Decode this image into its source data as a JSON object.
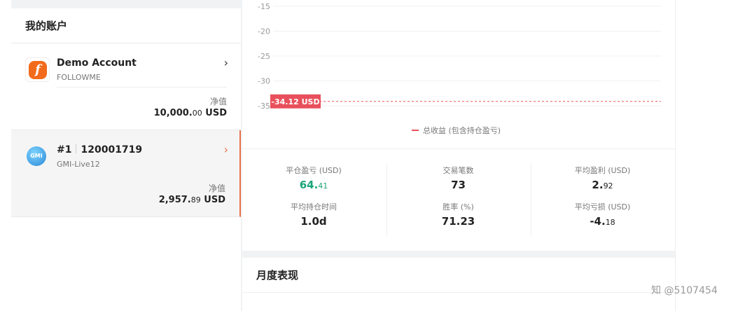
{
  "sidebar": {
    "title": "我的账户",
    "accounts": [
      {
        "name": "Demo Account",
        "broker": "FOLLOWME",
        "equity_label": "净值",
        "equity_int": "10,000.",
        "equity_dec": "00",
        "currency": "USD",
        "logo": "followme-logo"
      },
      {
        "number": "#1",
        "account_id": "120001719",
        "broker": "GMI-Live12",
        "equity_label": "净值",
        "equity_int": "2,957.",
        "equity_dec": "89",
        "currency": "USD",
        "logo": "gmi-logo",
        "logo_text": "GMI",
        "selected": true
      }
    ]
  },
  "chart_data": {
    "type": "line",
    "y_ticks": [
      "-15",
      "-20",
      "-25",
      "-30",
      "-35"
    ],
    "y_tick_values": [
      -15,
      -20,
      -25,
      -30,
      -35
    ],
    "ylim": [
      -35,
      -15
    ],
    "series": [
      {
        "name": "总收益 (包含持仓盈亏)",
        "color": "#e8505b"
      }
    ],
    "current_value": -34.12,
    "current_label": "-34.12 USD",
    "legend": "总收益 (包含持仓盈亏)"
  },
  "stats": {
    "closed_pl": {
      "label": "平仓盈亏 (USD)",
      "int": "64.",
      "dec": "41"
    },
    "trades": {
      "label": "交易笔数",
      "value": "73"
    },
    "avg_profit": {
      "label": "平均盈利 (USD)",
      "int": "2.",
      "dec": "92"
    },
    "avg_hold": {
      "label": "平均持仓时间",
      "value": "1.0d"
    },
    "win_rate": {
      "label": "胜率 (%)",
      "value": "71.23"
    },
    "avg_loss": {
      "label": "平均亏损 (USD)",
      "int": "-4.",
      "dec": "18"
    }
  },
  "monthly": {
    "title": "月度表现"
  },
  "watermark": "知 @5107454",
  "colors": {
    "accent": "#e8704a",
    "positive": "#1aa57a",
    "negative_line": "#e8505b",
    "brand_orange": "#f26a1b"
  }
}
